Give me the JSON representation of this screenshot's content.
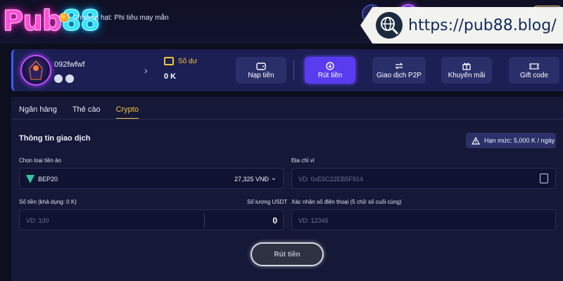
{
  "header": {
    "logo_left": "Pub",
    "logo_right": "88",
    "ticker_text": "Chương hạt: Phi tiêu may mắn",
    "url": "https://pub88.blog/"
  },
  "account": {
    "username": "092fwfwf",
    "balance_label": "Số dư",
    "balance_value": "0 K",
    "actions": [
      {
        "label": "Nạp tiền",
        "icon": "wallet-icon"
      },
      {
        "label": "Rút tiền",
        "icon": "withdraw-icon"
      },
      {
        "label": "Giao dịch P2P",
        "icon": "p2p-icon"
      },
      {
        "label": "Khuyến mãi",
        "icon": "gift-box-icon"
      },
      {
        "label": "Gift code",
        "icon": "ticket-icon"
      }
    ]
  },
  "tabs": [
    {
      "label": "Ngân hàng",
      "active": false
    },
    {
      "label": "Thẻ cào",
      "active": false
    },
    {
      "label": "Crypto",
      "active": true
    }
  ],
  "form": {
    "title": "Thông tin giao dịch",
    "limit": "Hạn mức: 5,000 K / ngày",
    "coin_label": "Chọn loại tiền ảo",
    "coin_selected": "BEP20",
    "coin_rate": "27,325 VNĐ",
    "wallet_label": "Địa chỉ ví",
    "wallet_placeholder": "VD: 0xE5C22EB5F914",
    "amount_label": "Số tiền (khả dụng: 0 K)",
    "usdt_label": "Số lượng USDT",
    "amount_placeholder": "VD: 100",
    "usdt_value": "0",
    "phone_label": "Xác nhận số điện thoại (5 chữ số cuối cùng)",
    "phone_placeholder": "VD: 12345",
    "submit_label": "Rút tiền"
  },
  "colors": {
    "accent_gold": "#f5c542",
    "active_button": "#5a3cf0",
    "panel_bg": "#151836"
  }
}
